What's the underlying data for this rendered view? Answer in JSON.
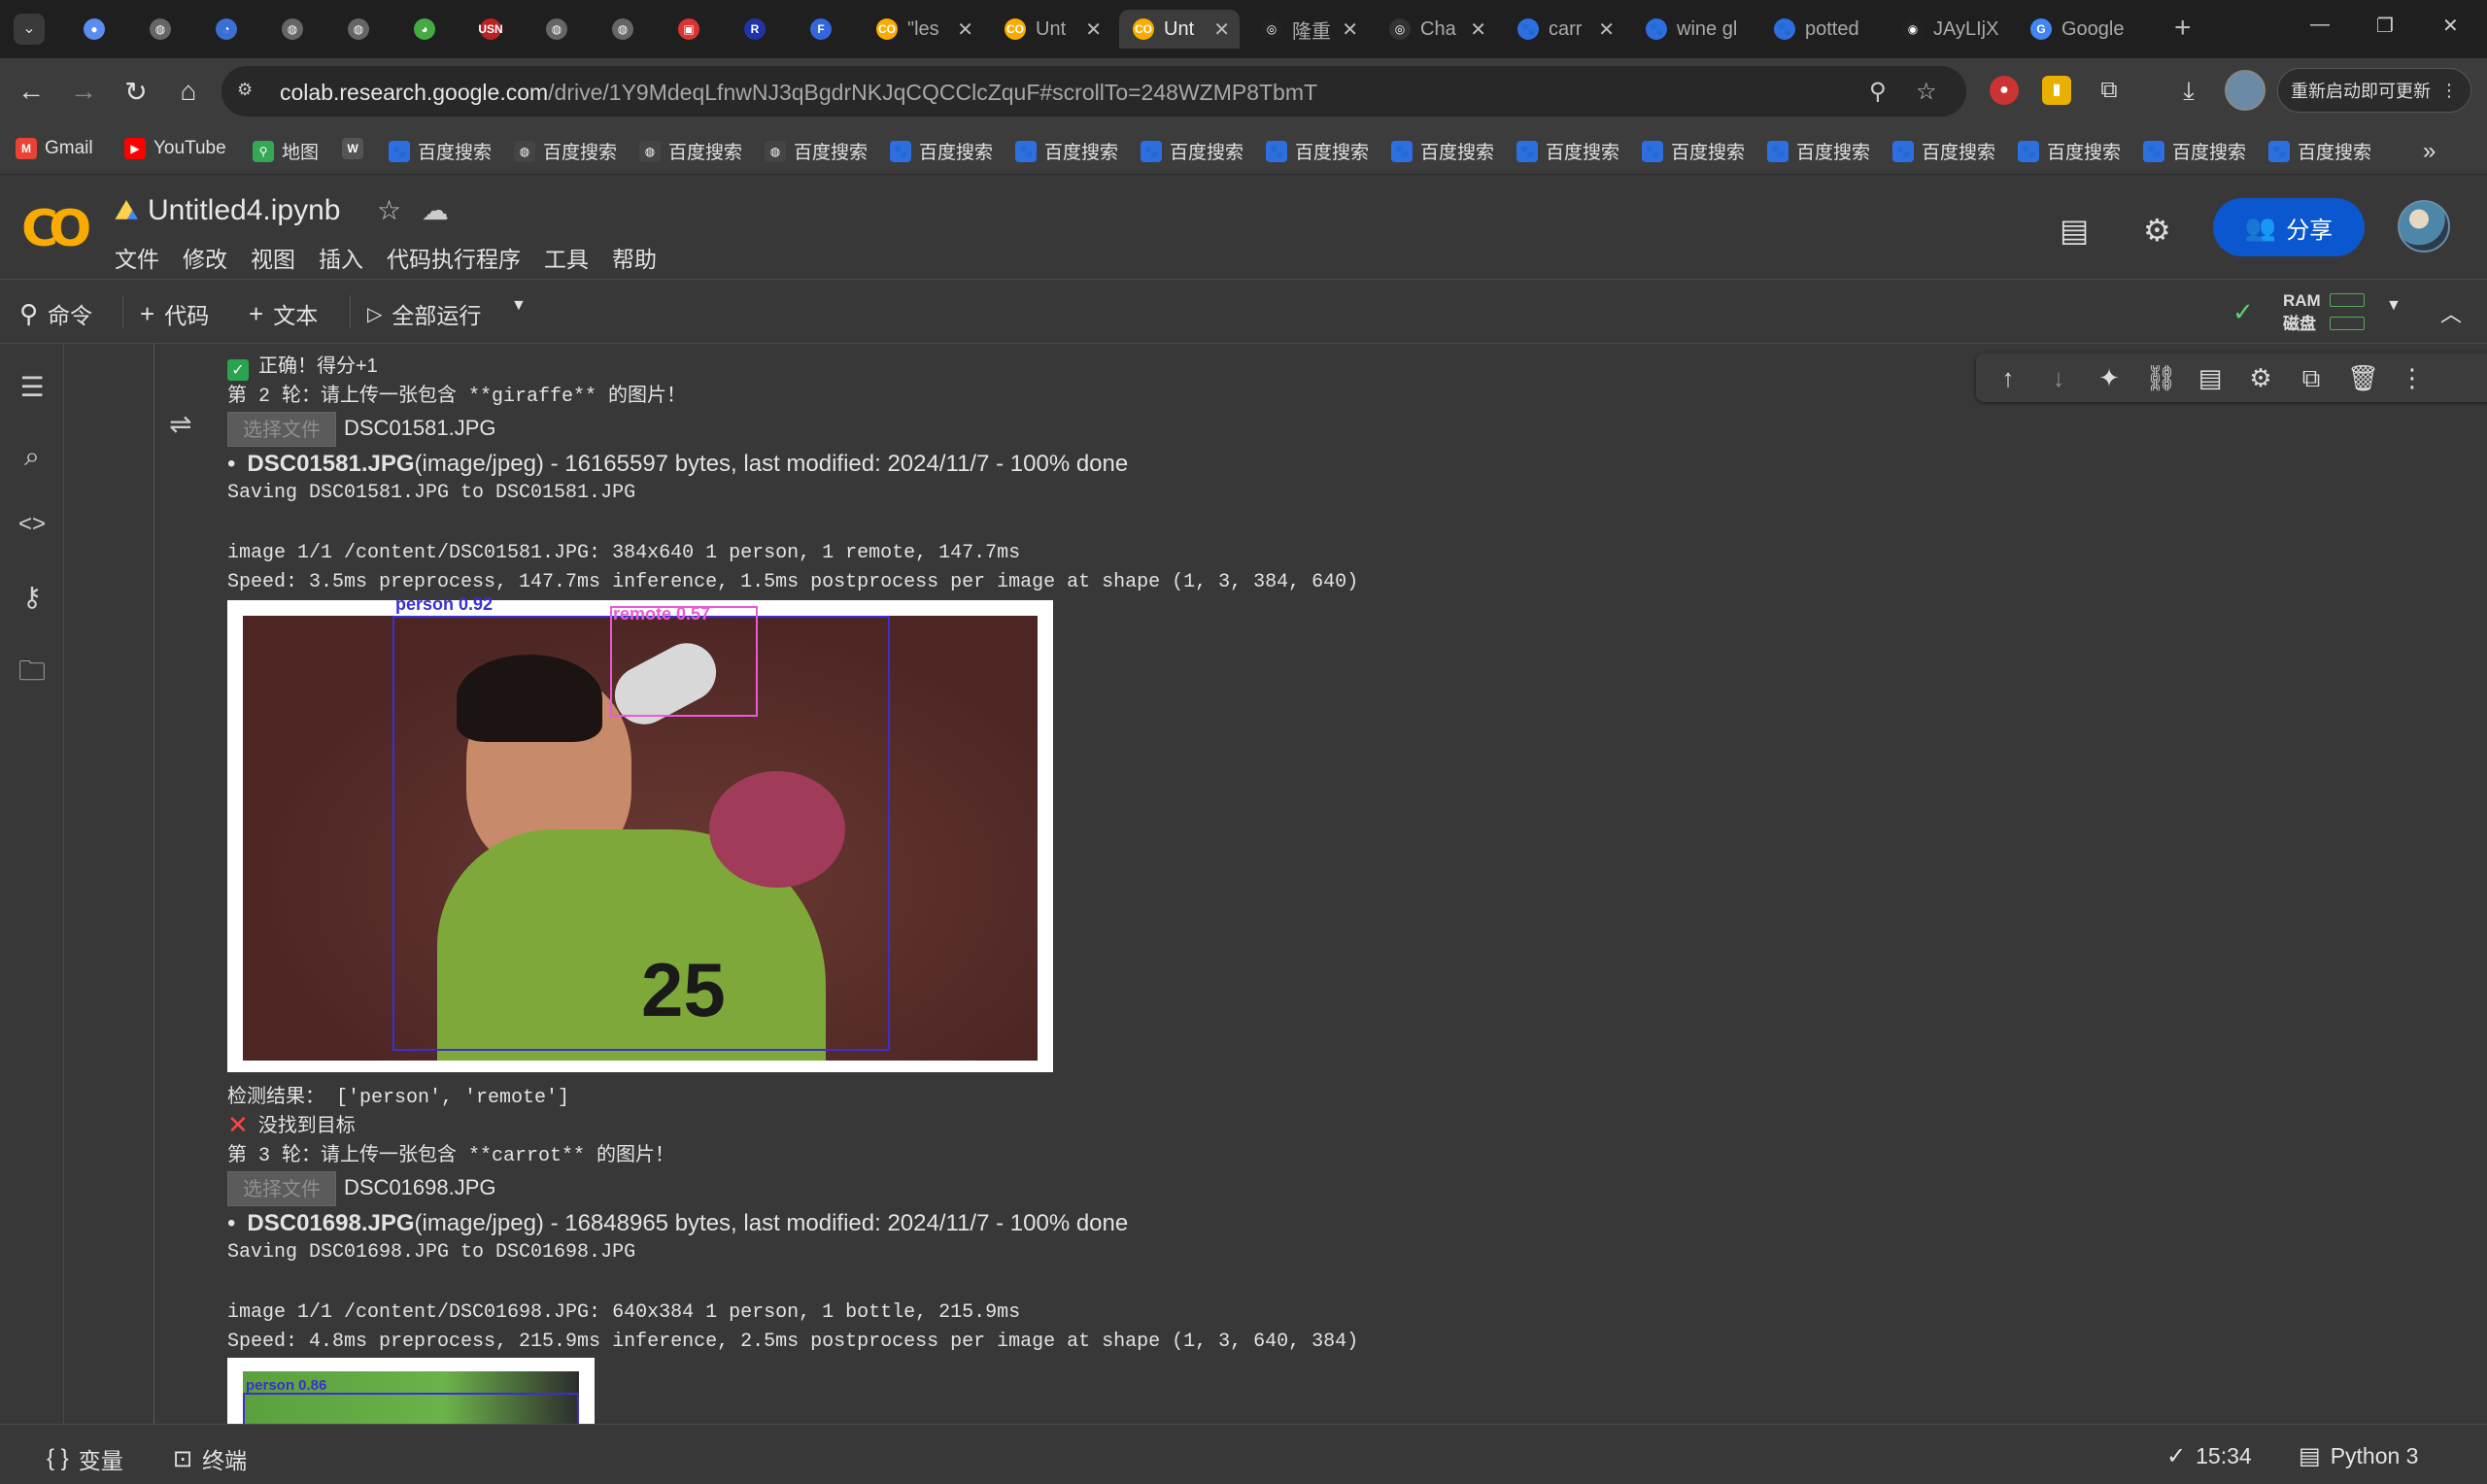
{
  "browser": {
    "tabs": [
      {
        "label": "",
        "color": "#5b8def",
        "fav": "●"
      },
      {
        "label": "",
        "color": "#666",
        "fav": "◍"
      },
      {
        "label": "",
        "color": "#3b6fd4",
        "fav": "◔"
      },
      {
        "label": "",
        "color": "#666",
        "fav": "◍"
      },
      {
        "label": "",
        "color": "#666",
        "fav": "◍"
      },
      {
        "label": "",
        "color": "#4a4",
        "fav": "◕"
      },
      {
        "label": "",
        "color": "#b22",
        "fav": "USN"
      },
      {
        "label": "",
        "color": "#666",
        "fav": "◍"
      },
      {
        "label": "",
        "color": "#666",
        "fav": "◍"
      },
      {
        "label": "",
        "color": "#d33",
        "fav": "▣"
      },
      {
        "label": "",
        "color": "#23a",
        "fav": "R"
      },
      {
        "label": "",
        "color": "#36d",
        "fav": "F"
      },
      {
        "label": "\"les",
        "color": "#f9ab00",
        "fav": "CO"
      },
      {
        "label": "Unt",
        "color": "#f9ab00",
        "fav": "CO"
      },
      {
        "label": "Unt",
        "color": "#f9ab00",
        "fav": "CO"
      },
      {
        "label": "隆重",
        "color": "#222",
        "fav": "◎"
      },
      {
        "label": "Cha",
        "color": "#333",
        "fav": "◎"
      },
      {
        "label": "carr",
        "color": "#2e6ee0",
        "fav": "🐾"
      },
      {
        "label": "wine gl",
        "color": "#2e6ee0",
        "fav": "🐾"
      },
      {
        "label": "potted",
        "color": "#2e6ee0",
        "fav": "🐾"
      },
      {
        "label": "JAyLIjX",
        "color": "#222",
        "fav": "◉"
      },
      {
        "label": "Google",
        "color": "#4285f4",
        "fav": "G"
      }
    ],
    "url_host": "colab.research.google.com",
    "url_path": "/drive/1Y9MdeqLfnwNJ3qBgdrNKJqCQCClcZquF#scrollTo=248WZMP8TbmT",
    "update_label": "重新启动即可更新",
    "bookmarks": [
      {
        "label": "Gmail",
        "icon": "M",
        "color": "#ea4335"
      },
      {
        "label": "YouTube",
        "icon": "▶",
        "color": "#ff0000"
      },
      {
        "label": "地图",
        "icon": "⚲",
        "color": "#34a853"
      },
      {
        "label": "",
        "icon": "W",
        "color": "#555"
      },
      {
        "label": "百度搜索",
        "icon": "🐾",
        "color": "#2e6ee0"
      },
      {
        "label": "百度搜索",
        "icon": "◍",
        "color": "#444"
      },
      {
        "label": "百度搜索",
        "icon": "◍",
        "color": "#444"
      },
      {
        "label": "百度搜索",
        "icon": "◍",
        "color": "#444"
      },
      {
        "label": "百度搜索",
        "icon": "🐾",
        "color": "#2e6ee0"
      },
      {
        "label": "百度搜索",
        "icon": "🐾",
        "color": "#2e6ee0"
      },
      {
        "label": "百度搜索",
        "icon": "🐾",
        "color": "#2e6ee0"
      },
      {
        "label": "百度搜索",
        "icon": "🐾",
        "color": "#2e6ee0"
      },
      {
        "label": "百度搜索",
        "icon": "🐾",
        "color": "#2e6ee0"
      },
      {
        "label": "百度搜索",
        "icon": "🐾",
        "color": "#2e6ee0"
      },
      {
        "label": "百度搜索",
        "icon": "🐾",
        "color": "#2e6ee0"
      },
      {
        "label": "百度搜索",
        "icon": "🐾",
        "color": "#2e6ee0"
      },
      {
        "label": "百度搜索",
        "icon": "🐾",
        "color": "#2e6ee0"
      },
      {
        "label": "百度搜索",
        "icon": "🐾",
        "color": "#2e6ee0"
      },
      {
        "label": "百度搜索",
        "icon": "🐾",
        "color": "#2e6ee0"
      },
      {
        "label": "百度搜索",
        "icon": "🐾",
        "color": "#2e6ee0"
      }
    ]
  },
  "colab": {
    "notebook_title": "Untitled4.ipynb",
    "menu": [
      "文件",
      "修改",
      "视图",
      "插入",
      "代码执行程序",
      "工具",
      "帮助"
    ],
    "share_label": "分享",
    "toolbar": {
      "command": "命令",
      "code": "代码",
      "text": "文本",
      "run_all": "全部运行"
    },
    "ram_label": "RAM",
    "disk_label": "磁盘"
  },
  "output": {
    "correct_line": "正确！得分+1",
    "round2_prompt": "第 2 轮：请上传一张包含 **giraffe** 的图片！",
    "choose_file": "选择文件",
    "file1_name": "DSC01581.JPG",
    "file1_bold": "DSC01581.JPG",
    "file1_info": "(image/jpeg) - 16165597 bytes, last modified: 2024/11/7 - 100% done",
    "file1_saving": "Saving DSC01581.JPG to DSC01581.JPG",
    "file1_image_line": "image 1/1 /content/DSC01581.JPG: 384x640 1 person, 1 remote, 147.7ms",
    "file1_speed_line": "Speed: 3.5ms preprocess, 147.7ms inference, 1.5ms postprocess per image at shape (1, 3, 384, 640)",
    "detect1_person": "person 0.92",
    "detect1_remote": "remote 0.57",
    "detect_result": "检测结果： ['person', 'remote']",
    "miss_line": "没找到目标",
    "round3_prompt": "第 3 轮：请上传一张包含 **carrot** 的图片！",
    "file2_name": "DSC01698.JPG",
    "file2_bold": "DSC01698.JPG",
    "file2_info": "(image/jpeg) - 16848965 bytes, last modified: 2024/11/7 - 100% done",
    "file2_saving": "Saving DSC01698.JPG to DSC01698.JPG",
    "file2_image_line": "image 1/1 /content/DSC01698.JPG: 640x384 1 person, 1 bottle, 215.9ms",
    "file2_speed_line": "Speed: 4.8ms preprocess, 215.9ms inference, 2.5ms postprocess per image at shape (1, 3, 640, 384)",
    "detect2_person": "person 0.86"
  },
  "statusbar": {
    "variables": "变量",
    "terminal": "终端",
    "time": "15:34",
    "runtime": "Python 3"
  },
  "colors": {
    "accent": "#0b57d0",
    "colab_orange": "#f9ab00",
    "person_box": "#3a2fd0",
    "remote_box": "#e85ad8",
    "success": "#2aa44f",
    "error": "#ff4444"
  }
}
